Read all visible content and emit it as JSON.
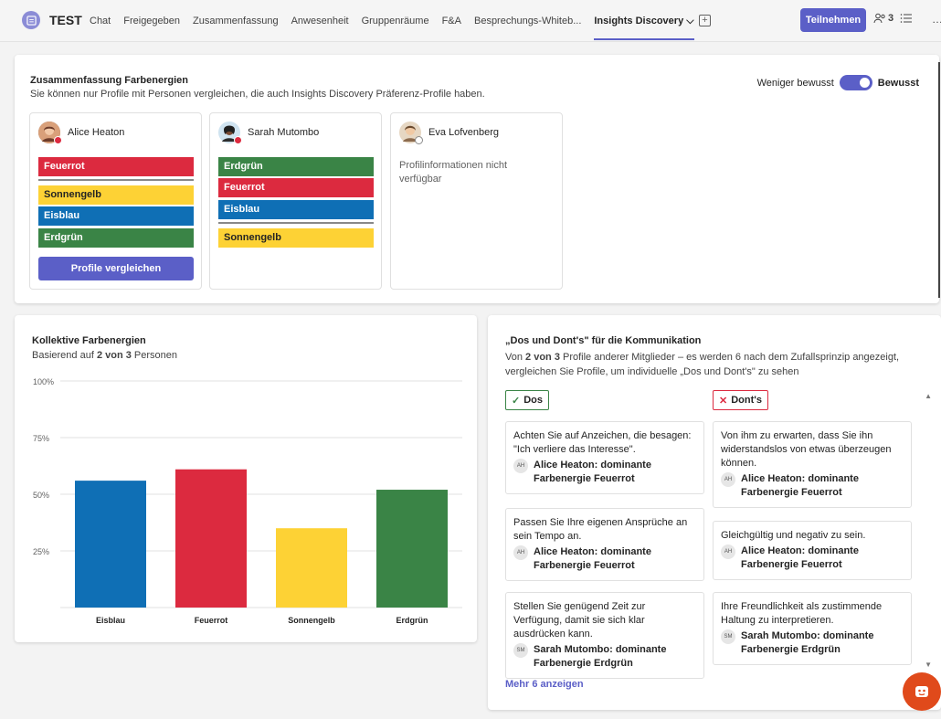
{
  "header": {
    "meeting_title": "TEST",
    "tabs": [
      {
        "label": "Chat"
      },
      {
        "label": "Freigegeben"
      },
      {
        "label": "Zusammenfassung"
      },
      {
        "label": "Anwesenheit"
      },
      {
        "label": "Gruppenräume"
      },
      {
        "label": "F&A"
      },
      {
        "label": "Besprechungs-Whiteb..."
      },
      {
        "label": "Insights Discovery ⌵"
      }
    ],
    "join_label": "Teilnehmen",
    "participant_count": "3",
    "more": "…"
  },
  "summary": {
    "title": "Zusammenfassung Farbenergien",
    "subtitle": "Sie können nur Profile mit Personen vergleichen, die auch Insights Discovery Präferenz-Profile haben.",
    "toggle_left": "Weniger bewusst",
    "toggle_right": "Bewusst",
    "compare_label": "Profile vergleichen",
    "unavailable": "Profilinformationen nicht verfügbar",
    "people": [
      {
        "name": "Alice Heaton",
        "bars": [
          "Feuerrot",
          "Sonnengelb",
          "Eisblau",
          "Erdgrün"
        ]
      },
      {
        "name": "Sarah Mutombo",
        "bars": [
          "Erdgrün",
          "Feuerrot",
          "Eisblau",
          "Sonnengelb"
        ]
      },
      {
        "name": "Eva Lofvenberg"
      }
    ]
  },
  "colors": {
    "Feuerrot": "#dc2a3f",
    "Sonnengelb": "#fdd235",
    "Eisblau": "#0f6fb5",
    "Erdgrün": "#3a8446",
    "accent": "#5b5fc7"
  },
  "collective": {
    "title": "Kollektive Farbenergien",
    "based_pre": "Basierend auf ",
    "based_bold": "2 von 3",
    "based_post": " Personen"
  },
  "chart_data": {
    "type": "bar",
    "categories": [
      "Eisblau",
      "Feuerrot",
      "Sonnengelb",
      "Erdgrün"
    ],
    "values": [
      56,
      61,
      35,
      52
    ],
    "ylim": [
      0,
      100
    ],
    "yticks": [
      "25%",
      "50%",
      "75%",
      "100%"
    ],
    "colors": [
      "#0f6fb5",
      "#dc2a3f",
      "#fdd235",
      "#3a8446"
    ],
    "grid": true
  },
  "dos": {
    "title": "„Dos und Dont's\" für die Kommunikation",
    "desc_pre": "Von ",
    "desc_bold": "2 von 3",
    "desc_post": " Profile anderer Mitglieder – es werden 6 nach dem Zufallsprinzip angezeigt, vergleichen Sie Profile, um individuelle „Dos und Dont's\" zu sehen",
    "dos_label": "Dos",
    "donts_label": "Dont's",
    "dos_items": [
      {
        "text": "Achten Sie auf Anzeichen, die besagen: \"Ich verliere das Interesse\".",
        "initials": "AH",
        "who": "Alice Heaton: dominante Farbenergie Feuerrot"
      },
      {
        "text": "Passen Sie Ihre eigenen Ansprüche an sein Tempo an.",
        "initials": "AH",
        "who": "Alice Heaton: dominante Farbenergie Feuerrot"
      },
      {
        "text": "Stellen Sie genügend Zeit zur Verfügung, damit sie sich klar ausdrücken kann.",
        "initials": "SM",
        "who": "Sarah Mutombo: dominante Farbenergie Erdgrün"
      }
    ],
    "donts_items": [
      {
        "text": "Von ihm zu erwarten, dass Sie ihn widerstandslos von etwas überzeugen können.",
        "initials": "AH",
        "who": "Alice Heaton: dominante Farbenergie Feuerrot"
      },
      {
        "text": "Gleichgültig und negativ zu sein.",
        "initials": "AH",
        "who": "Alice Heaton: dominante Farbenergie Feuerrot"
      },
      {
        "text": "Ihre Freundlichkeit als zustimmende Haltung zu interpretieren.",
        "initials": "SM",
        "who": "Sarah Mutombo: dominante Farbenergie Erdgrün"
      }
    ],
    "more_label": "Mehr 6 anzeigen"
  }
}
